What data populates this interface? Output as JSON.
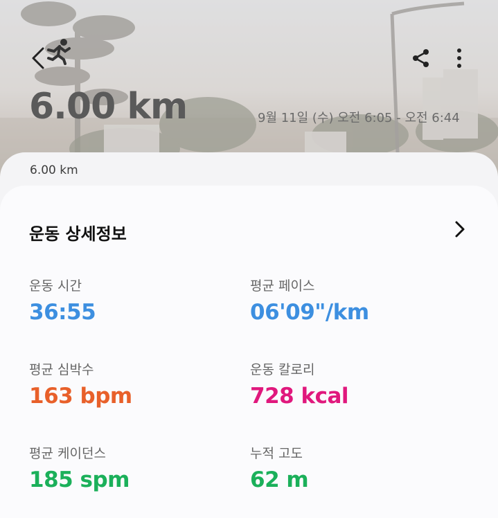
{
  "header": {
    "distance": "6.00 km",
    "date_range": "9월 11일 (수) 오전 6:05 - 오전 6:44",
    "icons": {
      "back": "back-chevron-icon",
      "activity": "running-icon",
      "share": "share-icon",
      "more": "more-vertical-icon"
    }
  },
  "summary": {
    "distance": "6.00 km"
  },
  "details": {
    "title": "운동 상세정보",
    "metrics": [
      {
        "label": "운동 시간",
        "value": "36:55",
        "color": "#3d8fe0"
      },
      {
        "label": "평균 페이스",
        "value": "06'09\"/km",
        "color": "#3d8fe0"
      },
      {
        "label": "평균 심박수",
        "value": "163 bpm",
        "color": "#e8602a"
      },
      {
        "label": "운동 칼로리",
        "value": "728 kcal",
        "color": "#e0187d"
      },
      {
        "label": "평균 케이던스",
        "value": "185 spm",
        "color": "#1bb05a"
      },
      {
        "label": "누적 고도",
        "value": "62 m",
        "color": "#1bb05a"
      }
    ]
  }
}
